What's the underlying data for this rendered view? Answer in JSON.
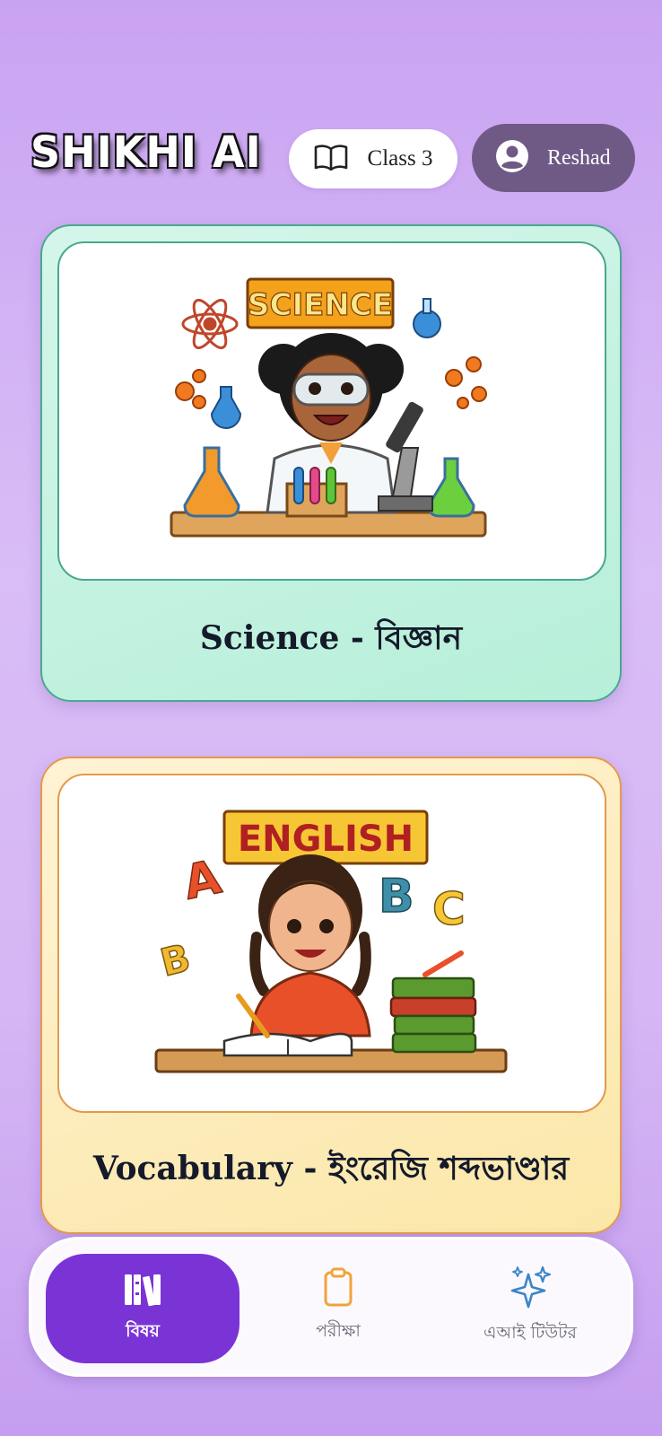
{
  "app": {
    "logo_text": "SHIKHI AI"
  },
  "header": {
    "class_label": "Class 3",
    "class_icon": "open-book-icon",
    "user_name": "Reshad",
    "user_icon": "user-avatar-icon"
  },
  "subjects": [
    {
      "title": "Science - বিজ্ঞান",
      "image_banner": "SCIENCE",
      "accent": "#4aa88f"
    },
    {
      "title": "Vocabulary - ইংরেজি শব্দভাণ্ডার",
      "image_banner": "ENGLISH",
      "accent": "#e39a4c"
    }
  ],
  "nav": {
    "items": [
      {
        "label": "বিষয়",
        "icon": "library-books-icon",
        "active": true
      },
      {
        "label": "পরীক্ষা",
        "icon": "clipboard-icon",
        "active": false
      },
      {
        "label": "এআই টিউটর",
        "icon": "sparkles-icon",
        "active": false
      }
    ],
    "active_color": "#7a34d6"
  }
}
